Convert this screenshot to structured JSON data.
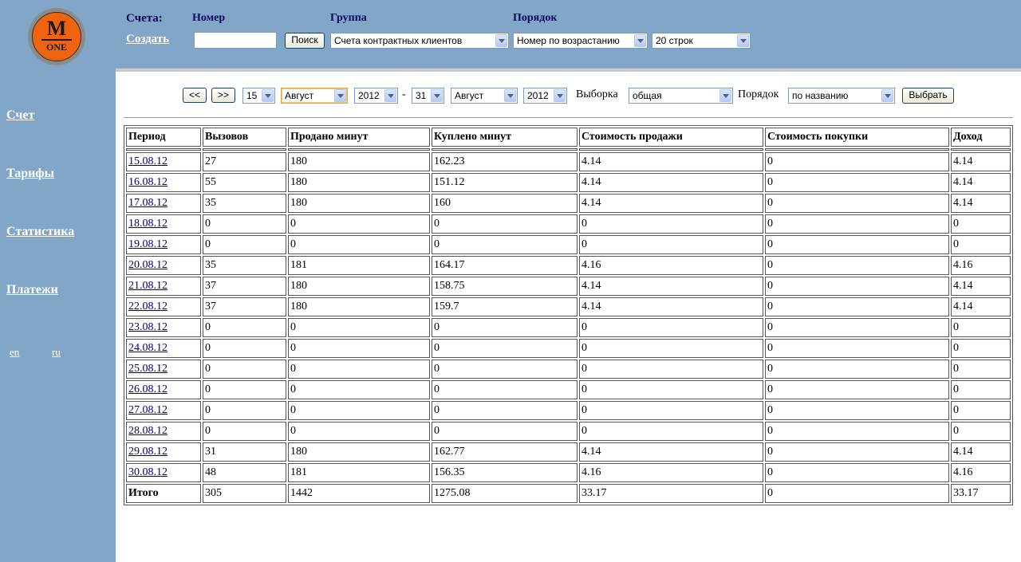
{
  "brand": {
    "logo_letter": "M",
    "logo_sub": "ONE"
  },
  "sidebar": {
    "items": [
      {
        "label": "Счет"
      },
      {
        "label": "Тарифы"
      },
      {
        "label": "Статистика"
      },
      {
        "label": "Платежи"
      }
    ],
    "langs": [
      "en",
      "ru"
    ]
  },
  "header": {
    "accounts_label": "Счета:",
    "create_link": "Создать",
    "number_label": "Номер",
    "group_label": "Группа",
    "order_label": "Порядок",
    "number_value": "",
    "search_button": "Поиск",
    "group_select": "Счета контрактных клиентов",
    "order_select": "Номер по возрастанию",
    "rows_select": "20 строк"
  },
  "filter": {
    "prev_button": "<<",
    "next_button": ">>",
    "from_day": "15",
    "from_month": "Август",
    "from_year": "2012",
    "dash": "-",
    "to_day": "31",
    "to_month": "Август",
    "to_year": "2012",
    "selection_label": "Выборка",
    "selection_value": "общая",
    "order_label": "Порядок",
    "order_value": "по названию",
    "apply_button": "Выбрать"
  },
  "table": {
    "headers": [
      "Период",
      "Вызовов",
      "Продано минут",
      "Куплено минут",
      "Стоимость продажи",
      "Стоимость покупки",
      "Доход"
    ],
    "rows": [
      [
        "15.08.12",
        "27",
        "180",
        "162.23",
        "4.14",
        "0",
        "4.14"
      ],
      [
        "16.08.12",
        "55",
        "180",
        "151.12",
        "4.14",
        "0",
        "4.14"
      ],
      [
        "17.08.12",
        "35",
        "180",
        "160",
        "4.14",
        "0",
        "4.14"
      ],
      [
        "18.08.12",
        "0",
        "0",
        "0",
        "0",
        "0",
        "0"
      ],
      [
        "19.08.12",
        "0",
        "0",
        "0",
        "0",
        "0",
        "0"
      ],
      [
        "20.08.12",
        "35",
        "181",
        "164.17",
        "4.16",
        "0",
        "4.16"
      ],
      [
        "21.08.12",
        "37",
        "180",
        "158.75",
        "4.14",
        "0",
        "4.14"
      ],
      [
        "22.08.12",
        "37",
        "180",
        "159.7",
        "4.14",
        "0",
        "4.14"
      ],
      [
        "23.08.12",
        "0",
        "0",
        "0",
        "0",
        "0",
        "0"
      ],
      [
        "24.08.12",
        "0",
        "0",
        "0",
        "0",
        "0",
        "0"
      ],
      [
        "25.08.12",
        "0",
        "0",
        "0",
        "0",
        "0",
        "0"
      ],
      [
        "26.08.12",
        "0",
        "0",
        "0",
        "0",
        "0",
        "0"
      ],
      [
        "27.08.12",
        "0",
        "0",
        "0",
        "0",
        "0",
        "0"
      ],
      [
        "28.08.12",
        "0",
        "0",
        "0",
        "0",
        "0",
        "0"
      ],
      [
        "29.08.12",
        "31",
        "180",
        "162.77",
        "4.14",
        "0",
        "4.14"
      ],
      [
        "30.08.12",
        "48",
        "181",
        "156.35",
        "4.16",
        "0",
        "4.16"
      ]
    ],
    "total": [
      "Итого",
      "305",
      "1442",
      "1275.08",
      "33.17",
      "0",
      "33.17"
    ]
  }
}
